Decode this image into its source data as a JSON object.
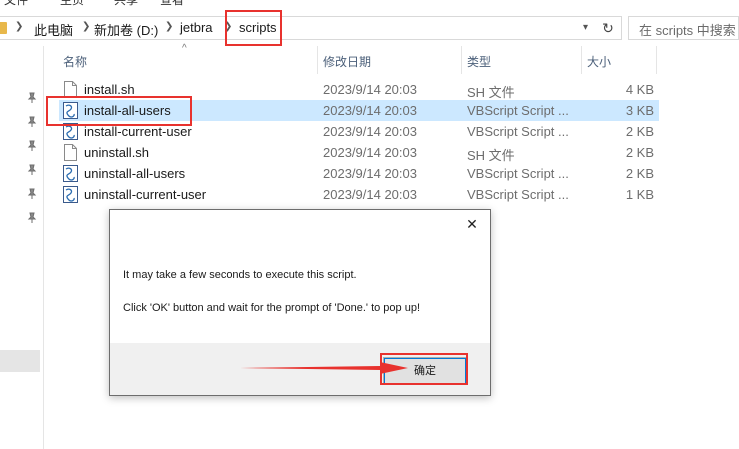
{
  "ribbon": {
    "items": [
      "文件",
      "主页",
      "共享",
      "查看"
    ]
  },
  "address": {
    "crumbs": [
      "此电脑",
      "新加卷 (D:)",
      "jetbra",
      "scripts"
    ],
    "search_placeholder": "在 scripts 中搜索"
  },
  "columns": {
    "name": "名称",
    "date": "修改日期",
    "type": "类型",
    "size": "大小"
  },
  "files": [
    {
      "name": "install.sh",
      "date": "2023/9/14 20:03",
      "type": "SH 文件",
      "size": "4 KB",
      "icon": "sh-file-icon"
    },
    {
      "name": "install-all-users",
      "date": "2023/9/14 20:03",
      "type": "VBScript Script ...",
      "size": "3 KB",
      "icon": "vbscript-file-icon",
      "selected": true
    },
    {
      "name": "install-current-user",
      "date": "2023/9/14 20:03",
      "type": "VBScript Script ...",
      "size": "2 KB",
      "icon": "vbscript-file-icon"
    },
    {
      "name": "uninstall.sh",
      "date": "2023/9/14 20:03",
      "type": "SH 文件",
      "size": "2 KB",
      "icon": "sh-file-icon"
    },
    {
      "name": "uninstall-all-users",
      "date": "2023/9/14 20:03",
      "type": "VBScript Script ...",
      "size": "2 KB",
      "icon": "vbscript-file-icon"
    },
    {
      "name": "uninstall-current-user",
      "date": "2023/9/14 20:03",
      "type": "VBScript Script ...",
      "size": "1 KB",
      "icon": "vbscript-file-icon"
    }
  ],
  "dialog": {
    "message_line1": "It may take a few seconds to execute this script.",
    "message_line2": "Click 'OK' button and wait for the prompt of 'Done.' to pop up!",
    "ok_label": "确定",
    "close_glyph": "✕"
  },
  "colors": {
    "highlight": "#e8322e",
    "selection": "#cce8ff",
    "header_text": "#4c607a"
  }
}
